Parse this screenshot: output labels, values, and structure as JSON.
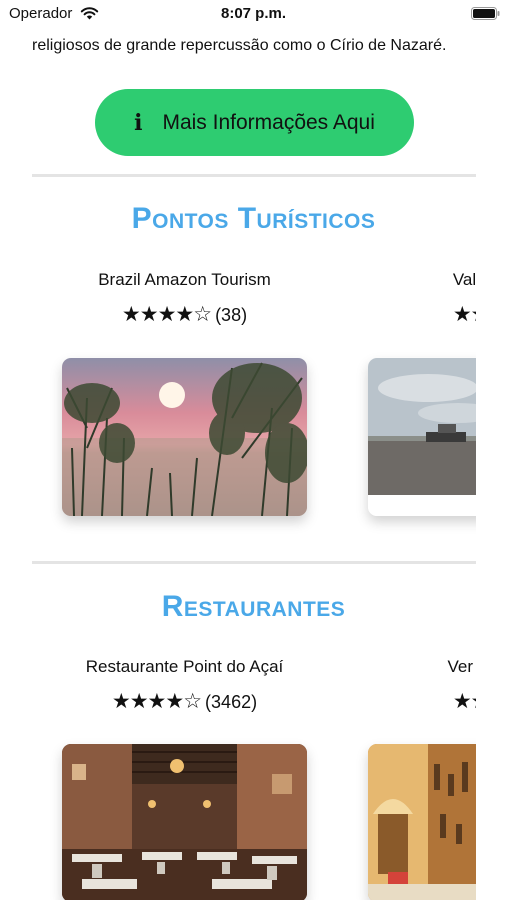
{
  "status_bar": {
    "carrier": "Operador",
    "time": "8:07 p.m."
  },
  "intro": {
    "text": "religiosos de grande repercussão como o Círio de Nazaré."
  },
  "info_button": {
    "icon": "i",
    "label": "Mais Informações Aqui"
  },
  "tourist_section": {
    "title": "Pontos Turísticos",
    "items": [
      {
        "name": "Brazil Amazon Tourism",
        "stars": "★★★★☆",
        "count": "(38)"
      },
      {
        "name": "Valeverde",
        "stars": "★★★★",
        "count": ""
      }
    ]
  },
  "restaurant_section": {
    "title": "Restaurantes",
    "items": [
      {
        "name": "Restaurante Point do Açaí",
        "stars": "★★★★☆",
        "count": "(3462)"
      },
      {
        "name": "Ver O Açaí,",
        "stars": "★★★★",
        "count": ""
      }
    ]
  },
  "colors": {
    "accent": "#4aa8e8",
    "button": "#2ecc71",
    "divider": "#e4e4e4"
  }
}
